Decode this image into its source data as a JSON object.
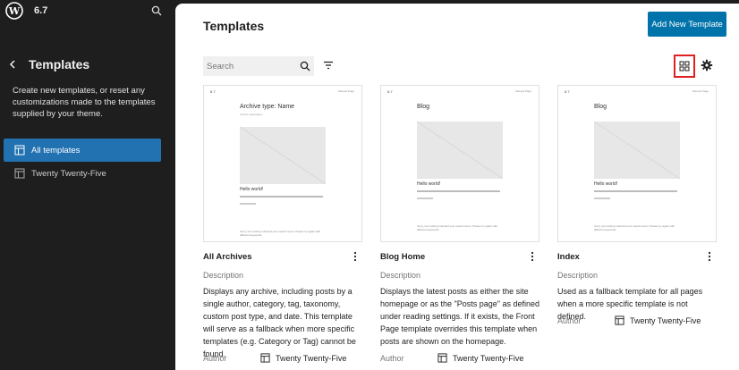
{
  "sidebar": {
    "site_name": "6.7",
    "title": "Templates",
    "description": "Create new templates, or reset any customizations made to the templates supplied by your theme.",
    "items": [
      {
        "label": "All templates",
        "active": true
      },
      {
        "label": "Twenty Twenty-Five",
        "active": false
      }
    ]
  },
  "main": {
    "title": "Templates",
    "add_button": "Add New Template",
    "search_placeholder": "Search"
  },
  "cards": [
    {
      "title": "All Archives",
      "description_label": "Description",
      "description": "Displays any archive, including posts by a single author, category, tag, taxonomy, custom post type, and date. This template will serve as a fallback when more specific templates (e.g. Category or Tag) cannot be found.",
      "author_label": "Author",
      "author": "Twenty Twenty-Five",
      "preview": {
        "site": "6.7",
        "menu": "Sample Page",
        "heading": "Archive type: Name",
        "subheading": "Archive description",
        "post_title": "Hello world!",
        "footer": "Sorry, but nothing matched your search terms. Please try again with different keywords."
      }
    },
    {
      "title": "Blog Home",
      "description_label": "Description",
      "description": "Displays the latest posts as either the site homepage or as the \"Posts page\" as defined under reading settings. If it exists, the Front Page template overrides this template when posts are shown on the homepage.",
      "author_label": "Author",
      "author": "Twenty Twenty-Five",
      "preview": {
        "site": "6.7",
        "menu": "Sample Page",
        "heading": "Blog",
        "post_title": "Hello world!",
        "footer": "Sorry, but nothing matched your search terms. Please try again with different keywords."
      }
    },
    {
      "title": "Index",
      "description_label": "Description",
      "description": "Used as a fallback template for all pages when a more specific template is not defined.",
      "author_label": "Author",
      "author": "Twenty Twenty-Five",
      "preview": {
        "site": "6.7",
        "menu": "Sample Page",
        "heading": "Blog",
        "post_title": "Hello world!",
        "footer": "Sorry, but nothing matched your search terms. Please try again with different keywords."
      }
    }
  ],
  "icons": {
    "wordpress": "wordpress-logo-icon",
    "search": "search-icon",
    "back": "chevron-left-icon",
    "layout": "layout-icon",
    "filter": "funnel-icon",
    "grid": "grid-view-icon",
    "gear": "gear-icon",
    "more": "more-vertical-icon"
  },
  "colors": {
    "accent": "#0073aa",
    "highlight": "#e02020",
    "sidebar_bg": "#1e1e1e"
  }
}
